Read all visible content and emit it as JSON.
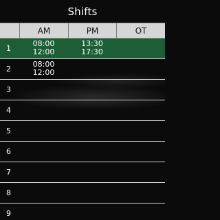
{
  "title": "Shifts",
  "columns": [
    "",
    "AM",
    "PM",
    "OT"
  ],
  "rows": [
    {
      "num": "1",
      "am": [
        "08:00",
        "12:00"
      ],
      "pm": [
        "13:30",
        "17:30"
      ],
      "ot": [],
      "selected": true
    },
    {
      "num": "2",
      "am": [
        "08:00",
        "12:00"
      ],
      "pm": [],
      "ot": [],
      "selected": false
    },
    {
      "num": "3",
      "am": [],
      "pm": [],
      "ot": [],
      "selected": false
    },
    {
      "num": "4",
      "am": [],
      "pm": [],
      "ot": [],
      "selected": false
    },
    {
      "num": "5",
      "am": [],
      "pm": [],
      "ot": [],
      "selected": false
    },
    {
      "num": "6",
      "am": [],
      "pm": [],
      "ot": [],
      "selected": false
    },
    {
      "num": "7",
      "am": [],
      "pm": [],
      "ot": [],
      "selected": false
    },
    {
      "num": "8",
      "am": [],
      "pm": [],
      "ot": [],
      "selected": false
    },
    {
      "num": "9",
      "am": [],
      "pm": [],
      "ot": [],
      "selected": false
    }
  ],
  "colors": {
    "selected_row": "#1e5e36",
    "header_bg": "#d6d6d6",
    "background": "#0b0b0b"
  }
}
